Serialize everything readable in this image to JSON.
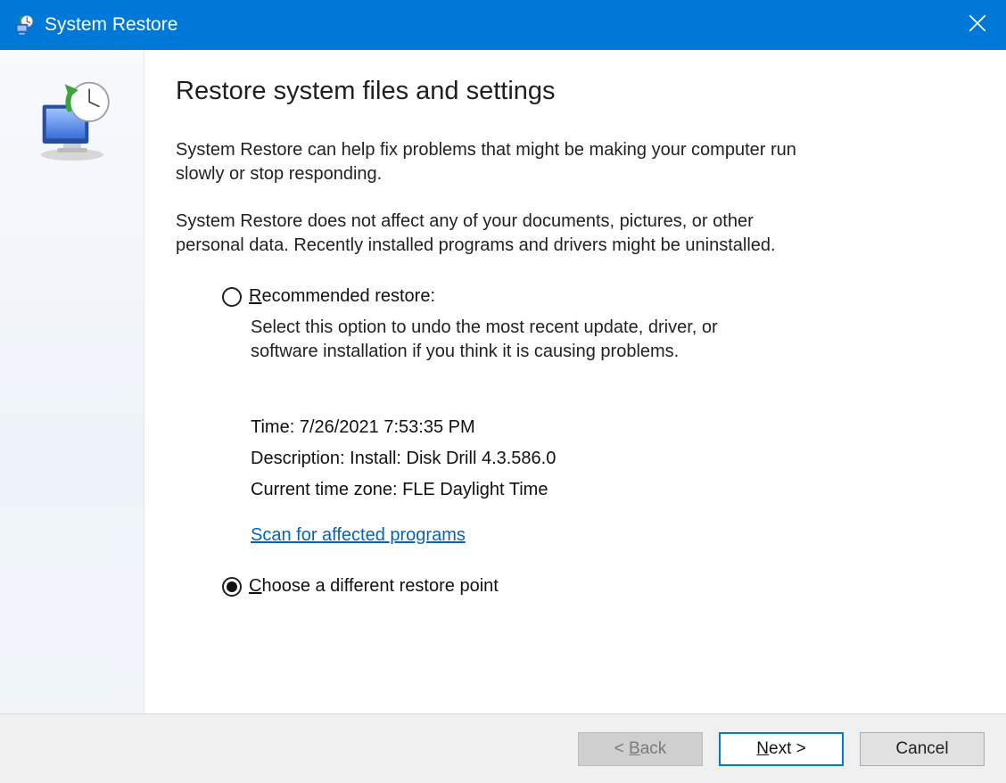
{
  "title": "System Restore",
  "heading": "Restore system files and settings",
  "para1": "System Restore can help fix problems that might be making your computer run slowly or stop responding.",
  "para2": "System Restore does not affect any of your documents, pictures, or other personal data. Recently installed programs and drivers might be uninstalled.",
  "option_recommended": {
    "label_pre": "R",
    "label_rest": "ecommended restore:",
    "desc": "Select this option to undo the most recent update, driver, or software installation if you think it is causing problems."
  },
  "details": {
    "time": "Time: 7/26/2021 7:53:35 PM",
    "description": "Description: Install: Disk Drill 4.3.586.0",
    "timezone": "Current time zone: FLE Daylight Time"
  },
  "scan_link": "Scan for affected programs",
  "option_choose": {
    "label_pre": "C",
    "label_rest": "hoose a different restore point"
  },
  "buttons": {
    "back_pre": "< ",
    "back_u": "B",
    "back_rest": "ack",
    "next_u": "N",
    "next_rest": "ext >",
    "cancel": "Cancel"
  }
}
